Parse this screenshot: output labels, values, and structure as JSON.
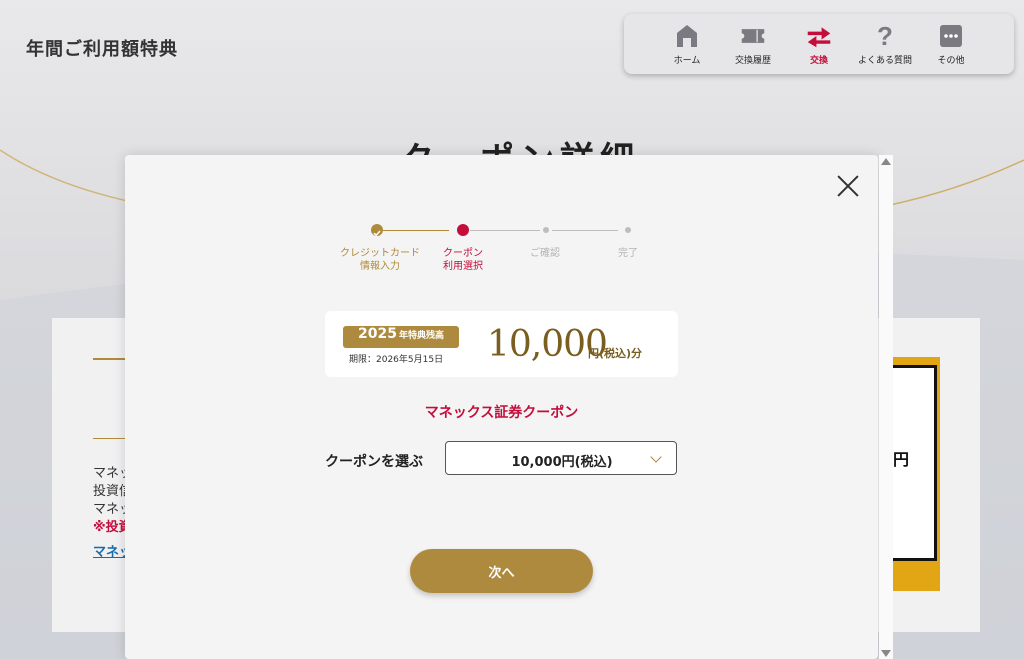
{
  "app": {
    "title": "年間ご利用額特典"
  },
  "background": {
    "heading": "クーポン詳細",
    "card_lines": [
      "マネッ",
      "投資信",
      "マネッ"
    ],
    "card_red": "※投資",
    "card_link": "マネッ",
    "coupon_yen": "円"
  },
  "nav": {
    "items": [
      {
        "label": "ホーム",
        "icon": "home-icon"
      },
      {
        "label": "交換履歴",
        "icon": "ticket-icon"
      },
      {
        "label": "交換",
        "icon": "exchange-arrows-icon",
        "active": true
      },
      {
        "label": "よくある質問",
        "icon": "question-icon"
      },
      {
        "label": "その他",
        "icon": "more-dots-icon"
      }
    ]
  },
  "modal": {
    "steps": [
      {
        "label": "クレジットカード\n情報入力",
        "state": "done"
      },
      {
        "label": "クーポン\n利用選択",
        "state": "current"
      },
      {
        "label": "ご確認",
        "state": "todo"
      },
      {
        "label": "完了",
        "state": "todo"
      }
    ],
    "balance": {
      "year": "2025",
      "badge_text": "年特典残高",
      "expiry": "期限：2026年5月15日",
      "amount": "10,000",
      "amount_suffix": "円(税込)分"
    },
    "coupon_name": "マネックス証券クーポン",
    "select": {
      "label": "クーポンを選ぶ",
      "value": "10,000円(税込)"
    },
    "next_button": "次へ"
  },
  "colors": {
    "gold": "#ae8a3e",
    "accent_red": "#c40d3b",
    "coupon_yellow": "#e2a614"
  }
}
